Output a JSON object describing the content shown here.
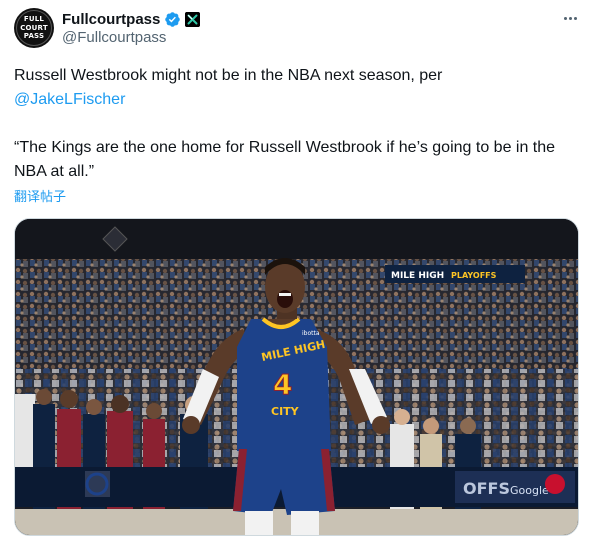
{
  "author": {
    "display_name": "Fullcourtpass",
    "handle": "@Fullcourtpass",
    "avatar_lines": [
      "FULL",
      "COURT",
      "PASS"
    ],
    "verified_color": "#1d9bf0"
  },
  "tweet": {
    "line1_text": "Russell Westbrook might not be in the NBA next season, per",
    "mention": "@JakeLFischer",
    "quote": "“The Kings are the one home for Russell Westbrook if he’s going to be in the NBA at all.”",
    "translate_label": "翻译帖子"
  },
  "media": {
    "banner_text": "MILE HIGH",
    "banner_sub": "PLAYOFFS",
    "jersey_top": "MILE HIGH",
    "jersey_number": "4",
    "jersey_bottom": "CITY",
    "jersey_brand": "ibotta",
    "board_right": "OFFS",
    "board_brand": "Google"
  },
  "icons": {
    "verified": "verified-badge-icon",
    "affiliation": "x-affiliate-icon",
    "more": "more-options-icon"
  }
}
